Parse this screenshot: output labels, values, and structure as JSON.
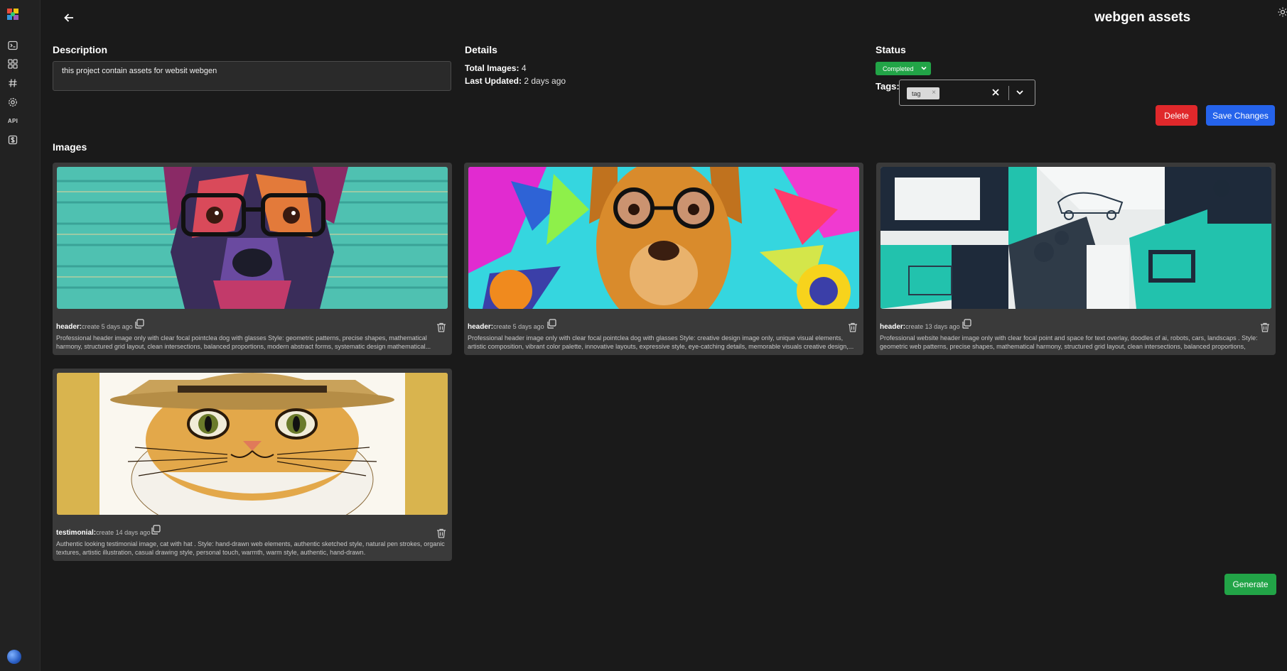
{
  "header": {
    "title": "webgen assets"
  },
  "sidebar": {
    "items": [
      {
        "icon": "terminal-icon"
      },
      {
        "icon": "grid-icon"
      },
      {
        "icon": "hash-icon"
      },
      {
        "icon": "gear-icon"
      },
      {
        "label": "API"
      },
      {
        "icon": "dollar-icon"
      }
    ]
  },
  "description": {
    "label": "Description",
    "value": "this project contain assets for websit webgen"
  },
  "details": {
    "label": "Details",
    "total_images_label": "Total Images:",
    "total_images_value": "4",
    "last_updated_label": "Last Updated:",
    "last_updated_value": "2 days ago"
  },
  "status": {
    "label": "Status",
    "value": "Completed",
    "color": "#22a447"
  },
  "tags": {
    "label": "Tags:",
    "items": [
      "tag"
    ]
  },
  "actions": {
    "delete_label": "Delete",
    "save_label": "Save Changes",
    "generate_label": "Generate"
  },
  "images": {
    "label": "Images",
    "cards": [
      {
        "type": "header:",
        "created": "create 5 days ago",
        "prompt": "Professional header image only with clear focal pointclea dog with glasses Style: geometric patterns, precise shapes, mathematical harmony, structured grid layout, clean intersections, balanced proportions, modern abstract forms, systematic design mathematical..."
      },
      {
        "type": "header:",
        "created": "create 5 days ago",
        "prompt": "Professional header image only with clear focal pointclea dog with glasses Style: creative design image only, unique visual elements, artistic composition, vibrant color palette, innovative layouts, expressive style, eye-catching details, memorable visuals creative design,..."
      },
      {
        "type": "header:",
        "created": "create 13 days ago",
        "prompt": "Professional website header image only with clear focal point and space for text overlay, doodles of ai, robots, cars, landscaps . Style: geometric web patterns, precise shapes, mathematical harmony, structured grid layout, clean intersections, balanced proportions, moder..."
      },
      {
        "type": "testimonial:",
        "created": "create 14 days ago",
        "prompt": "Authentic looking testimonial image, cat with hat . Style: hand-drawn web elements, authentic sketched style, natural pen strokes, organic textures, artistic illustration, casual drawing style, personal touch, warmth, warm style, authentic, hand-drawn."
      }
    ]
  }
}
